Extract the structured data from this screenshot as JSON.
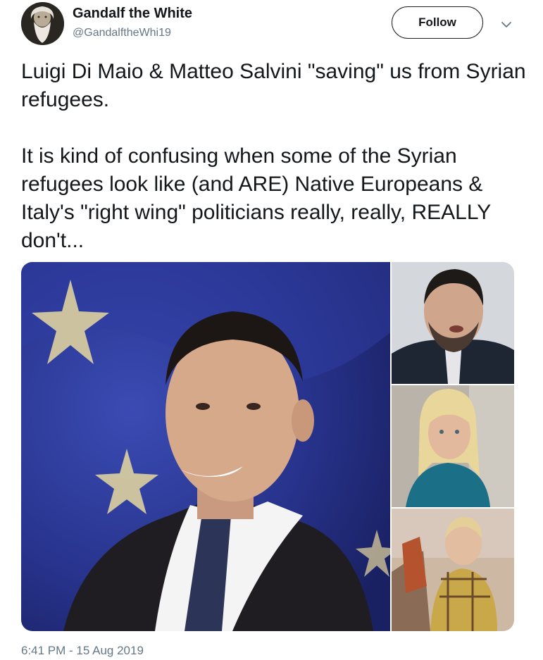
{
  "author": {
    "display_name": "Gandalf the White",
    "handle": "@GandalftheWhi19",
    "avatar_icon": "bearded-man-avatar"
  },
  "actions": {
    "follow_label": "Follow",
    "more_icon": "chevron-down-icon"
  },
  "tweet": {
    "paragraphs": [
      "Luigi Di Maio & Matteo Salvini \"saving\" us from Syrian refugees.",
      "It is kind of confusing when some of the Syrian refugees look like (and ARE) Native Europeans & Italy's \"right wing\" politicians really, really, REALLY don't..."
    ],
    "timestamp": "6:41 PM - 15 Aug 2019"
  },
  "colors": {
    "text": "#14171a",
    "secondary": "#657786",
    "eu_blue": "#2e3b9e",
    "star": "#e8d9a0"
  }
}
